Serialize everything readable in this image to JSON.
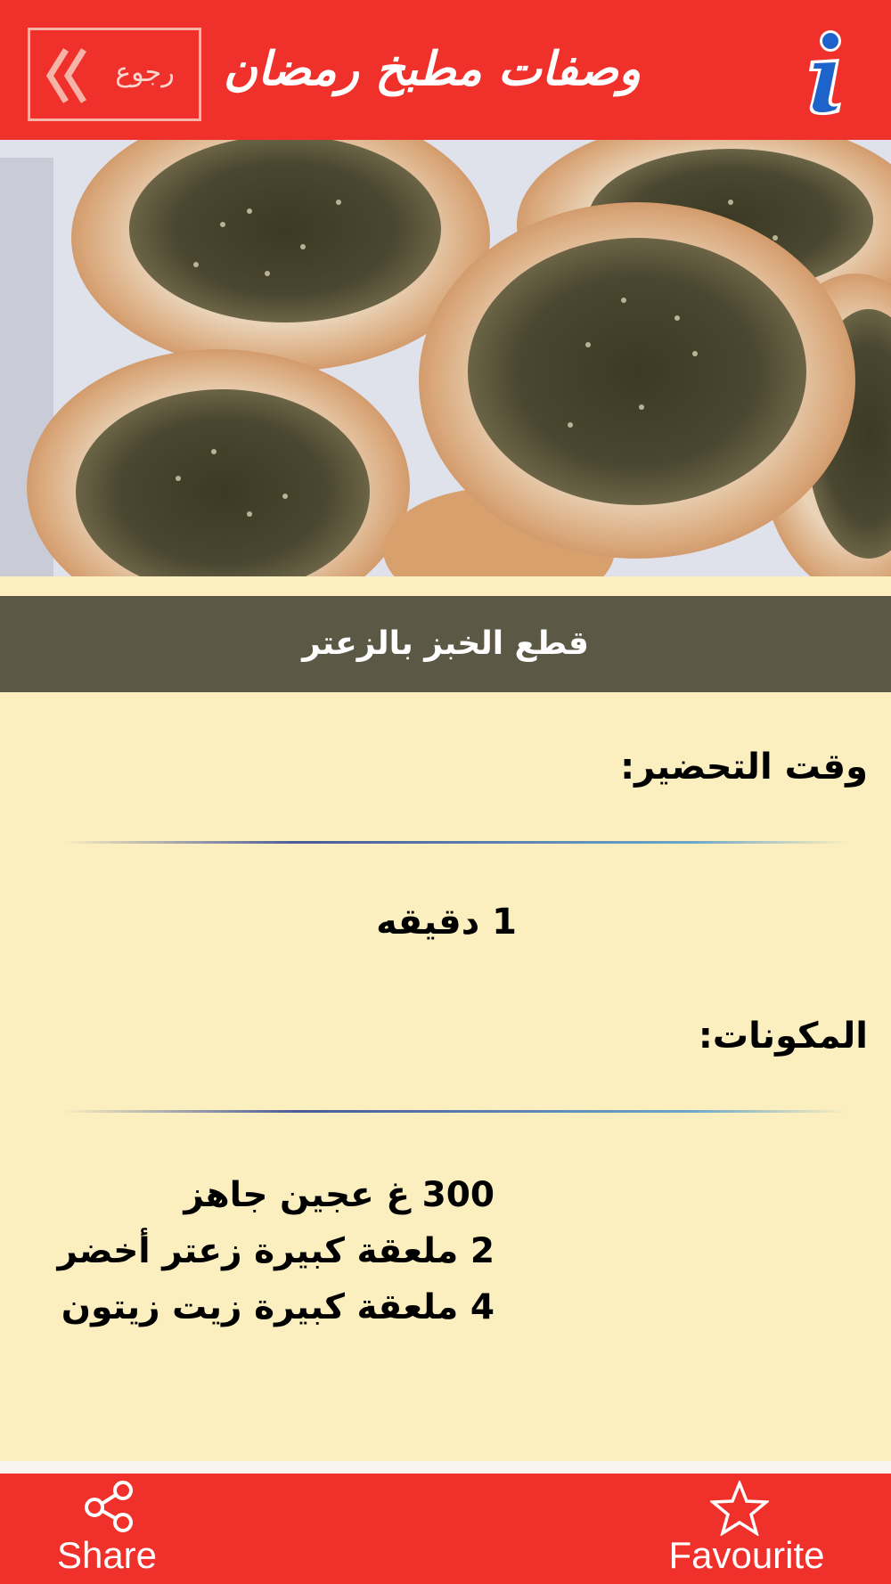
{
  "header": {
    "title": "وصفات مطبخ رمضان",
    "back_label": "رجوع"
  },
  "recipe": {
    "title": "قطع الخبز بالزعتر",
    "prep_heading": "وقت التحضير:",
    "prep_value": "1 دقيقه",
    "ingredients_heading": "المكونات:",
    "ingredients": [
      "300 غ عجين جاهز",
      "2 ملعقة كبيرة زعتر أخضر",
      "4 ملعقة كبيرة زيت زيتون"
    ]
  },
  "bottom_bar": {
    "share_label": "Share",
    "favourite_label": "Favourite"
  },
  "icons": {
    "back": "double-chevron-left-icon",
    "info": "info-icon",
    "share": "share-icon",
    "favourite": "star-icon"
  },
  "colors": {
    "primary_red": "#f0302a",
    "title_band": "#5b5946",
    "background": "#fbeebf"
  }
}
